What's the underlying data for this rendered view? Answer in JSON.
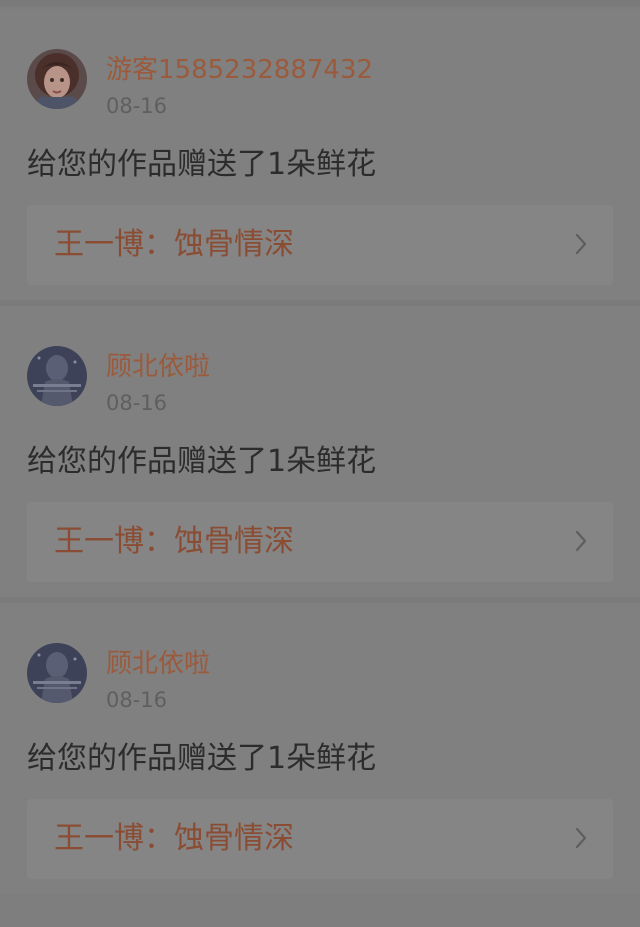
{
  "gifts": [
    {
      "username": "游客1585232887432",
      "time": "08-16",
      "message": "给您的作品赠送了1朵鲜花",
      "work_title": "王一博：蚀骨情深",
      "avatar_icon": "girl-portrait-avatar"
    },
    {
      "username": "顾北依啦",
      "time": "08-16",
      "message": "给您的作品赠送了1朵鲜花",
      "work_title": "王一博：蚀骨情深",
      "avatar_icon": "night-scene-avatar"
    },
    {
      "username": "顾北依啦",
      "time": "08-16",
      "message": "给您的作品赠送了1朵鲜花",
      "work_title": "王一博：蚀骨情深",
      "avatar_icon": "night-scene-avatar"
    }
  ],
  "colors": {
    "username": "#9b5a3b",
    "work_title": "#8a4d34",
    "overlay_background": "#808080"
  },
  "icons": {
    "chevron": "chevron-right-icon"
  }
}
